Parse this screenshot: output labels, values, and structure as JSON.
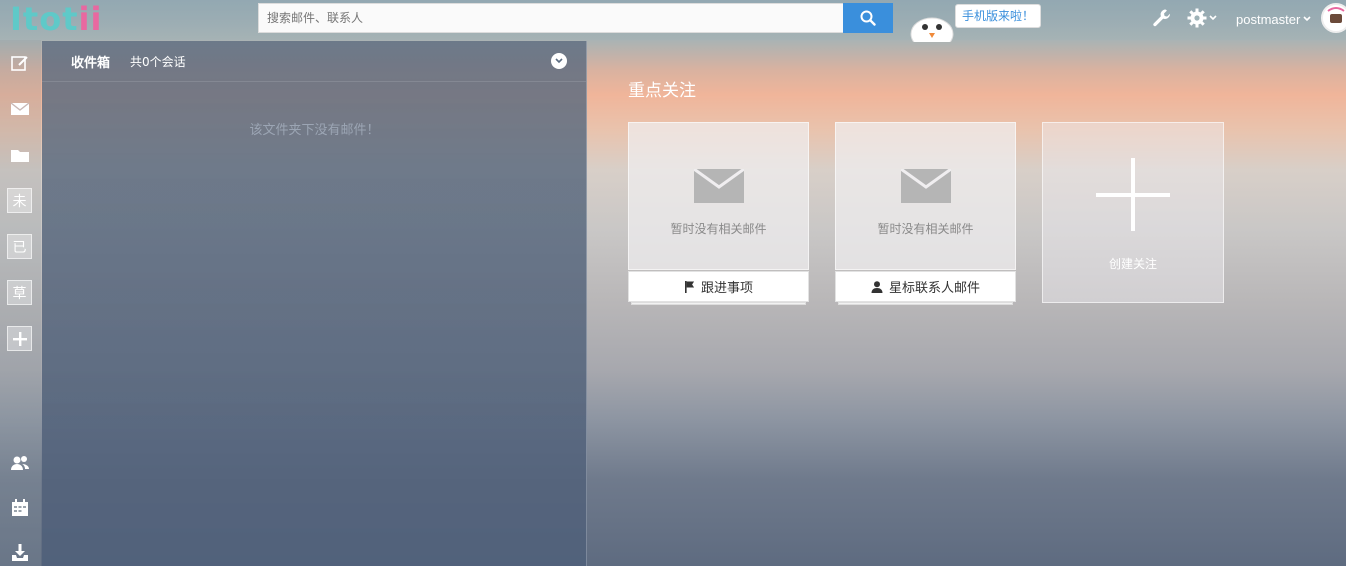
{
  "header": {
    "logo_main": "Itot",
    "logo_accent": "ii",
    "search_placeholder": "搜索邮件、联系人",
    "mobile_tip": "手机版来啦！",
    "user_name": "postmaster"
  },
  "sidebar": {
    "unread_label": "未",
    "read_label": "已",
    "draft_label": "草"
  },
  "inbox": {
    "title": "收件箱",
    "count_text": "共0个会话",
    "empty_message": "该文件夹下没有邮件！"
  },
  "focus": {
    "title": "重点关注",
    "cards": [
      {
        "empty_text": "暂时没有相关邮件",
        "footer_label": "跟进事项",
        "footer_icon": "flag-icon"
      },
      {
        "empty_text": "暂时没有相关邮件",
        "footer_label": "星标联系人邮件",
        "footer_icon": "person-icon"
      }
    ],
    "create_label": "创建关注"
  },
  "colors": {
    "accent": "#3a8fdc",
    "logo": "#5fc9c8",
    "logo_accent": "#e868a0"
  }
}
